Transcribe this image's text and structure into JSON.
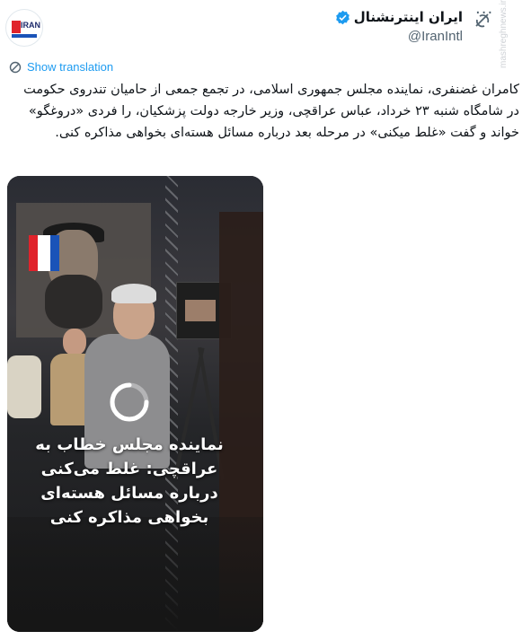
{
  "header": {
    "display_name": "ایران اینترنشنال",
    "handle": "@IranIntl",
    "more_label": "···",
    "avatar_text": "IRAN"
  },
  "translate": {
    "label": "Show translation"
  },
  "tweet": {
    "text": "کامران غضنفری، نماینده مجلس جمهوری اسلامی، در تجمع جمعی از حامیان تندروی حکومت در شامگاه شنبه ۲۳ خرداد، عباس عراقچی، وزیر خارجه دولت پزشکیان، را فردی «دروغگو» خواند و گفت «غلط میکنی» در مرحله بعد درباره مسائل هسته‌ای بخواهی مذاکره کنی."
  },
  "media": {
    "overlay_text": "نماینده مجلس خطاب به عراقچی: غلط می‌کنی درباره مسائل هسته‌ای بخواهی مذاکره کنی",
    "icons": [
      "play-loading-spinner",
      "channel-logo"
    ]
  },
  "colors": {
    "link": "#1d9bf0",
    "verified": "#1d9bf0",
    "text": "#0f1419",
    "secondary": "#536471"
  }
}
